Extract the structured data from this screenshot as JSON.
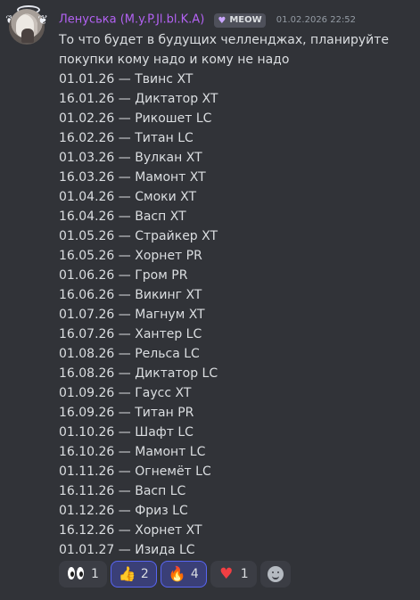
{
  "message": {
    "author": "Ленуська (M.y.P.Jl.bl.K.A)",
    "badge_label": "MEOW",
    "badge_icon": "heart-badge-icon",
    "timestamp": "01.02.2026 22:52",
    "text_lines": [
      "То что будет в будущих челленджах, планируйте",
      "покупки кому надо и кому не надо"
    ],
    "schedule": [
      "01.01.26 — Твинс XT",
      "16.01.26 — Диктатор XT",
      "01.02.26 — Рикошет LC",
      "16.02.26 — Титан LC",
      "01.03.26 — Вулкан XT",
      "16.03.26 — Мамонт XT",
      "01.04.26 — Смоки XT",
      "16.04.26 — Васп XT",
      "01.05.26 — Страйкер XT",
      "16.05.26 — Хорнет PR",
      "01.06.26 — Гром PR",
      "16.06.26 — Викинг XT",
      "01.07.26 — Магнум XT",
      "16.07.26 — Хантер LC",
      "01.08.26 — Рельса LC",
      "16.08.26 — Диктатор LC",
      "01.09.26 — Гаусс XT",
      "16.09.26 — Титан PR",
      "01.10.26 — Шафт LC",
      "16.10.26 — Мамонт LC",
      "01.11.26 — Огнемёт LC",
      "16.11.26 — Васп LC",
      "01.12.26 — Фриз LC",
      "16.12.26 — Хорнет XT",
      "01.01.27 — Изида LC"
    ]
  },
  "reactions": [
    {
      "icon": "eyes-icon",
      "count": "1",
      "selected": false
    },
    {
      "icon": "thumbs-up-icon",
      "count": "2",
      "selected": true
    },
    {
      "icon": "fire-icon",
      "count": "4",
      "selected": true
    },
    {
      "icon": "heart-icon",
      "count": "1",
      "selected": false
    },
    {
      "icon": "add-reaction-icon",
      "count": "",
      "selected": false
    }
  ],
  "colors": {
    "background": "#313338",
    "text": "#dbdee1",
    "username": "#b362f3",
    "timestamp": "#949ba4",
    "reaction_background": "#3b3d44",
    "reaction_selected_background": "#3a3f77",
    "reaction_selected_border": "#5865f2"
  }
}
